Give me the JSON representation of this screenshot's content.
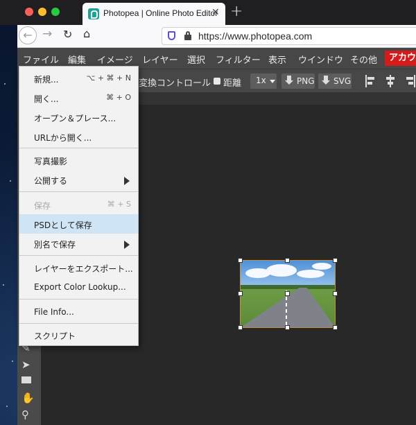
{
  "browser": {
    "tab_title": "Photopea | Online Photo Editor",
    "tab_close": "✕",
    "new_tab": "+",
    "url": "https://www.photopea.com",
    "traffic_light_colors": [
      "#fc5f57",
      "#fdbc2e",
      "#28c840"
    ]
  },
  "menubar": {
    "items": [
      "ファイル",
      "編集",
      "イメージ",
      "レイヤー",
      "選択",
      "フィルター",
      "表示",
      "ウインドウ",
      "その他"
    ],
    "account": "アカウン"
  },
  "toolbar": {
    "transform_controls": "変換コントロール",
    "distance": "距離",
    "zoom": "1x",
    "export_png": "PNG",
    "export_svg": "SVG"
  },
  "file_menu": {
    "items": [
      {
        "label": "新規...",
        "shortcut": "⌥ + ⌘ + N"
      },
      {
        "label": "開く...",
        "shortcut": "⌘ + O"
      },
      {
        "label": "オープン＆プレース...",
        "shortcut": ""
      },
      {
        "label": "URLから開く...",
        "shortcut": ""
      },
      {
        "label": "写真撮影",
        "shortcut": ""
      },
      {
        "label": "公開する",
        "shortcut": ""
      },
      {
        "label": "保存",
        "shortcut": "⌘ + S"
      },
      {
        "label": "PSDとして保存",
        "shortcut": ""
      },
      {
        "label": "別名で保存",
        "shortcut": ""
      },
      {
        "label": "レイヤーをエクスポート...",
        "shortcut": ""
      },
      {
        "label": "Export Color Lookup...",
        "shortcut": ""
      },
      {
        "label": "File Info...",
        "shortcut": ""
      },
      {
        "label": "スクリプト",
        "shortcut": ""
      }
    ],
    "highlighted_item": "PSDとして保存",
    "disabled_item": "保存",
    "highlight_color": "#cfe5f6"
  },
  "colors": {
    "menubar_bg": "#474747",
    "canvas_bg": "#282828",
    "account_button": "#d51a1a",
    "selection_border": "#c88c45"
  }
}
